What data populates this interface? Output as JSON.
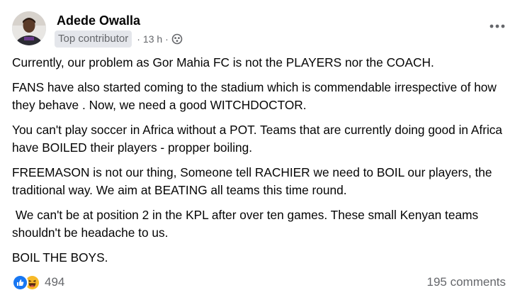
{
  "post": {
    "author": "Adede Owalla",
    "badge": "Top contributor",
    "separator": "·",
    "timestamp": "13 h",
    "audience_icon": "public-globe-icon",
    "more_icon": "more-options-icon",
    "paragraphs": [
      "Currently, our problem as Gor Mahia FC is not the PLAYERS nor the COACH.",
      "FANS have also started coming to the stadium which is commendable irrespective of how they behave . Now, we need a good WITCHDOCTOR.",
      "You can't play soccer in Africa without a POT. Teams that are currently doing good in Africa have BOILED their players - propper boiling.",
      "FREEMASON is not our thing, Someone tell RACHIER we need to BOIL our players, the traditional way. We aim at BEATING all teams this time round.",
      " We can't be at position 2 in the KPL after over ten games. These small Kenyan teams shouldn't be headache to us.",
      "BOIL THE BOYS."
    ],
    "reactions": {
      "icons": [
        "like-icon",
        "haha-icon"
      ],
      "count": "494"
    },
    "comments_label": "195 comments"
  },
  "colors": {
    "like_blue": "#1877f2",
    "haha_yellow": "#f7b928",
    "secondary_text": "#65676b",
    "badge_bg": "#e4e6eb"
  }
}
